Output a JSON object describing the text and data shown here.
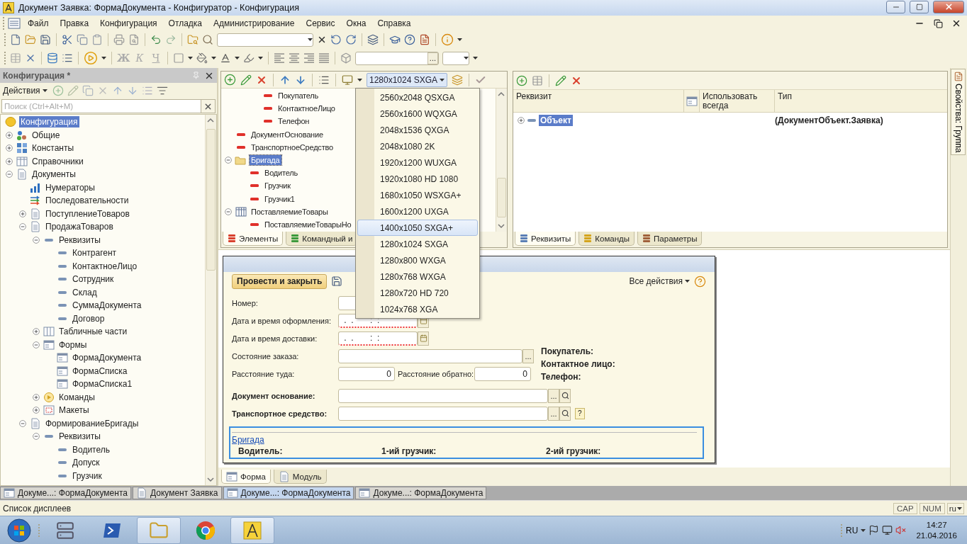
{
  "window": {
    "title": "Документ Заявка: ФормаДокумента - Конфигуратор - Конфигурация"
  },
  "menu": [
    "Файл",
    "Правка",
    "Конфигурация",
    "Отладка",
    "Администрирование",
    "Сервис",
    "Окна",
    "Справка"
  ],
  "format_toolbar": {
    "style_buttons": [
      {
        "label": "Ж",
        "kind": "bold"
      },
      {
        "label": "К",
        "kind": "italic"
      },
      {
        "label": "Ч",
        "kind": "underline"
      }
    ],
    "font_button": "..."
  },
  "config_panel": {
    "title": "Конфигурация *",
    "actions": "Действия",
    "search": {
      "placeholder": "Поиск (Ctrl+Alt+M)"
    },
    "tree": [
      {
        "label": "Конфигурация",
        "kind": "root",
        "selected": true
      },
      {
        "label": "Общие",
        "kind": "common",
        "expanded": false,
        "selected": false
      },
      {
        "label": "Константы",
        "kind": "constants",
        "expanded": false,
        "selected": false
      },
      {
        "label": "Справочники",
        "kind": "catalogs",
        "expanded": false,
        "selected": false
      },
      {
        "label": "Документы",
        "kind": "document",
        "expanded": true,
        "selected": false,
        "children": [
          {
            "label": "Нумераторы",
            "kind": "numerators",
            "selected": false
          },
          {
            "label": "Последовательности",
            "kind": "sequences",
            "selected": false
          },
          {
            "label": "ПоступлениеТоваров",
            "kind": "document",
            "expanded": false,
            "selected": false
          },
          {
            "label": "ПродажаТоваров",
            "kind": "document",
            "expanded": true,
            "selected": false,
            "children": [
              {
                "label": "Реквизиты",
                "kind": "attribute",
                "expanded": true,
                "selected": false,
                "children": [
                  {
                    "label": "Контрагент",
                    "kind": "attribute",
                    "selected": false
                  },
                  {
                    "label": "КонтактноеЛицо",
                    "kind": "attribute",
                    "selected": false
                  },
                  {
                    "label": "Сотрудник",
                    "kind": "attribute",
                    "selected": false
                  },
                  {
                    "label": "Склад",
                    "kind": "attribute",
                    "selected": false
                  },
                  {
                    "label": "СуммаДокумента",
                    "kind": "attribute",
                    "selected": false
                  },
                  {
                    "label": "Договор",
                    "kind": "attribute",
                    "selected": false
                  }
                ]
              },
              {
                "label": "Табличные части",
                "kind": "tables",
                "expanded": false,
                "selected": false
              },
              {
                "label": "Формы",
                "kind": "forms",
                "expanded": true,
                "selected": false,
                "children": [
                  {
                    "label": "ФормаДокумента",
                    "kind": "forms",
                    "selected": false
                  },
                  {
                    "label": "ФормаСписка",
                    "kind": "forms",
                    "selected": false
                  },
                  {
                    "label": "ФормаСписка1",
                    "kind": "forms",
                    "selected": false
                  }
                ]
              },
              {
                "label": "Команды",
                "kind": "commands",
                "expanded": false,
                "selected": false
              },
              {
                "label": "Макеты",
                "kind": "templates",
                "expanded": false,
                "selected": false
              }
            ]
          },
          {
            "label": "ФормированиеБригады",
            "kind": "document",
            "expanded": true,
            "selected": false,
            "children": [
              {
                "label": "Реквизиты",
                "kind": "attribute",
                "expanded": true,
                "selected": false,
                "children": [
                  {
                    "label": "Водитель",
                    "kind": "attribute",
                    "selected": false
                  },
                  {
                    "label": "Допуск",
                    "kind": "attribute",
                    "selected": false
                  },
                  {
                    "label": "Грузчик",
                    "kind": "attribute",
                    "selected": false
                  }
                ]
              }
            ]
          }
        ]
      }
    ]
  },
  "elements_panel": {
    "resolution": "1280x1024 SXGA",
    "resolution_list": [
      {
        "label": "2560x2048 QSXGA",
        "selected": false
      },
      {
        "label": "2560x1600 WQXGA",
        "selected": false
      },
      {
        "label": "2048x1536 QXGA",
        "selected": false
      },
      {
        "label": "2048x1080 2K",
        "selected": false
      },
      {
        "label": "1920x1200 WUXGA",
        "selected": false
      },
      {
        "label": "1920x1080 HD 1080",
        "selected": false
      },
      {
        "label": "1680x1050 WSXGA+",
        "selected": false
      },
      {
        "label": "1600x1200 UXGA",
        "selected": false
      },
      {
        "label": "1400x1050 SXGA+",
        "selected": true
      },
      {
        "label": "1280x1024 SXGA",
        "selected": false
      },
      {
        "label": "1280x800 WXGA",
        "selected": false
      },
      {
        "label": "1280x768 WXGA",
        "selected": false
      },
      {
        "label": "1280x720 HD 720",
        "selected": false
      },
      {
        "label": "1024x768 XGA",
        "selected": false
      }
    ],
    "tree": [
      {
        "children": [
          {
            "children": [
              {
                "label": "Покупатель",
                "kind": "field",
                "selected": false
              },
              {
                "label": "КонтактноеЛицо",
                "kind": "field",
                "selected": false
              },
              {
                "label": "Телефон",
                "kind": "field",
                "selected": false
              }
            ]
          }
        ]
      },
      {
        "label": "ДокументОснование",
        "kind": "field",
        "selected": false
      },
      {
        "label": "ТранспортноеСредство",
        "kind": "field",
        "selected": false
      },
      {
        "label": "Бригада",
        "kind": "folder",
        "expanded": true,
        "selected": true,
        "children": [
          {
            "label": "Водитель",
            "kind": "field",
            "selected": false
          },
          {
            "label": "Грузчик",
            "kind": "field",
            "selected": false
          },
          {
            "label": "Грузчик1",
            "kind": "field",
            "selected": false
          }
        ]
      },
      {
        "label": "ПоставляемиеТовары",
        "kind": "table",
        "expanded": true,
        "selected": false,
        "children": [
          {
            "label": "ПоставляемиеТоварыНо",
            "kind": "field",
            "selected": false
          }
        ]
      }
    ],
    "tabs": [
      {
        "label": "Элементы",
        "selected": true
      },
      {
        "label": "Командный и",
        "selected": false
      }
    ]
  },
  "attributes_panel": {
    "columns": [
      "Реквизит",
      "Использовать всегда",
      "Тип"
    ],
    "rows": [
      {
        "name": "Объект",
        "type": "(ДокументОбъект.Заявка)",
        "expanded": false,
        "selected": true
      }
    ],
    "tabs": [
      {
        "label": "Реквизиты",
        "selected": true
      },
      {
        "label": "Команды",
        "selected": false
      },
      {
        "label": "Параметры",
        "selected": false
      }
    ]
  },
  "form_preview": {
    "primary_button": "Провести и закрыть",
    "all_actions": "Все действия",
    "fields": [
      {
        "label": "Номер:",
        "kind": "text",
        "bold": false,
        "required": false
      },
      {
        "label": "Дата и время оформления:",
        "kind": "date",
        "value": " .  .       :  :",
        "bold": false,
        "required": true
      },
      {
        "label": "Дата и время доставки:",
        "kind": "date",
        "value": " .  .       :  :",
        "bold": false,
        "required": true
      },
      {
        "label": "Состояние заказа:",
        "kind": "choice",
        "button": "...",
        "bold": false,
        "required": false
      },
      {
        "label": "Расстояние туда:",
        "kind": "pair",
        "value": "0",
        "label_2": "Расстояние обратно:",
        "value_2": "0",
        "bold": false,
        "required": false
      },
      {
        "label": "Документ основание:",
        "kind": "reference",
        "button": "...",
        "bold": true,
        "required": false
      },
      {
        "label": "Транспортное средство:",
        "kind": "reference",
        "button": "...",
        "hint": "?",
        "bold": true,
        "required": false
      }
    ],
    "info": [
      "Покупатель:",
      "Контактное лицо:",
      "Телефон:"
    ],
    "group": {
      "title": "Бригада",
      "labels": [
        "Водитель:",
        "1-ий грузчик:",
        "2-ий грузчик:"
      ]
    }
  },
  "form_tabs": [
    {
      "label": "Форма",
      "selected": true
    },
    {
      "label": "Модуль",
      "selected": false
    }
  ],
  "properties_tab": "Свойства: Группа",
  "window_tabs": [
    {
      "label": "Докуме...: ФормаДокумента",
      "selected": false
    },
    {
      "label": "Документ Заявка",
      "selected": false
    },
    {
      "label": "Докуме...: ФормаДокумента",
      "selected": true
    },
    {
      "label": "Докуме...: ФормаДокумента",
      "selected": false
    }
  ],
  "status_bar": {
    "text": "Список дисплеев",
    "indicators": [
      "CAP",
      "NUM"
    ],
    "language": "ru"
  },
  "taskbar": {
    "apps": [
      {
        "kind": "server",
        "active": false
      },
      {
        "kind": "terminal",
        "active": false
      },
      {
        "kind": "explorer",
        "active": true
      },
      {
        "kind": "browser",
        "active": false
      },
      {
        "kind": "designer",
        "active": true
      }
    ],
    "language": "RU",
    "time": "14:27",
    "date": "21.04.2016"
  }
}
